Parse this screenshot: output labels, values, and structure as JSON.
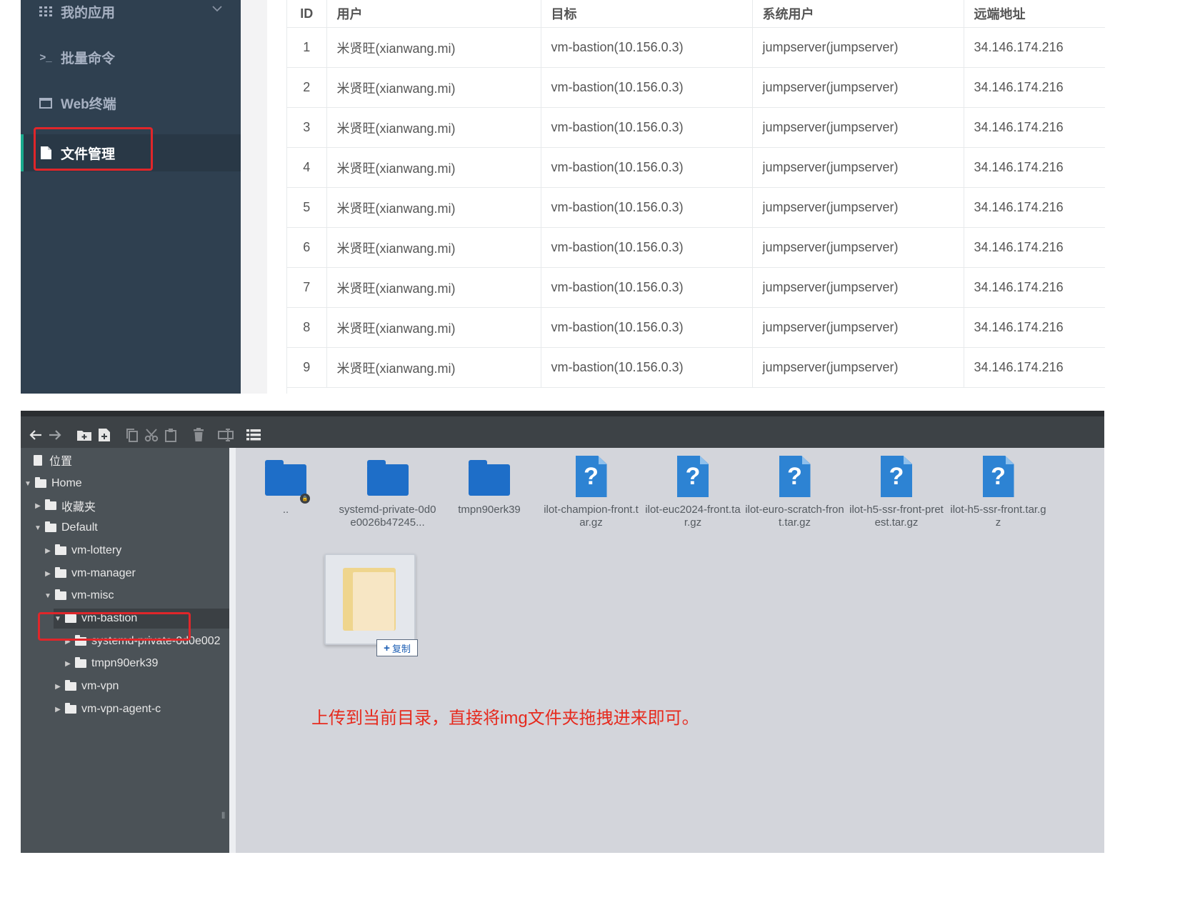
{
  "sidebar": {
    "items": [
      {
        "label": "我的应用",
        "icon": "grid-icon",
        "has_caret": true
      },
      {
        "label": "批量命令",
        "icon": "terminal-icon"
      },
      {
        "label": "Web终端",
        "icon": "window-icon"
      },
      {
        "label": "文件管理",
        "icon": "file-icon",
        "active": true
      }
    ]
  },
  "table": {
    "columns": [
      "ID",
      "用户",
      "目标",
      "系统用户",
      "远端地址"
    ],
    "rows": [
      {
        "id": "1",
        "user": "米贤旺(xianwang.mi)",
        "target": "vm-bastion(10.156.0.3)",
        "system_user": "jumpserver(jumpserver)",
        "remote_addr": "34.146.174.216"
      },
      {
        "id": "2",
        "user": "米贤旺(xianwang.mi)",
        "target": "vm-bastion(10.156.0.3)",
        "system_user": "jumpserver(jumpserver)",
        "remote_addr": "34.146.174.216"
      },
      {
        "id": "3",
        "user": "米贤旺(xianwang.mi)",
        "target": "vm-bastion(10.156.0.3)",
        "system_user": "jumpserver(jumpserver)",
        "remote_addr": "34.146.174.216"
      },
      {
        "id": "4",
        "user": "米贤旺(xianwang.mi)",
        "target": "vm-bastion(10.156.0.3)",
        "system_user": "jumpserver(jumpserver)",
        "remote_addr": "34.146.174.216"
      },
      {
        "id": "5",
        "user": "米贤旺(xianwang.mi)",
        "target": "vm-bastion(10.156.0.3)",
        "system_user": "jumpserver(jumpserver)",
        "remote_addr": "34.146.174.216"
      },
      {
        "id": "6",
        "user": "米贤旺(xianwang.mi)",
        "target": "vm-bastion(10.156.0.3)",
        "system_user": "jumpserver(jumpserver)",
        "remote_addr": "34.146.174.216"
      },
      {
        "id": "7",
        "user": "米贤旺(xianwang.mi)",
        "target": "vm-bastion(10.156.0.3)",
        "system_user": "jumpserver(jumpserver)",
        "remote_addr": "34.146.174.216"
      },
      {
        "id": "8",
        "user": "米贤旺(xianwang.mi)",
        "target": "vm-bastion(10.156.0.3)",
        "system_user": "jumpserver(jumpserver)",
        "remote_addr": "34.146.174.216"
      },
      {
        "id": "9",
        "user": "米贤旺(xianwang.mi)",
        "target": "vm-bastion(10.156.0.3)",
        "system_user": "jumpserver(jumpserver)",
        "remote_addr": "34.146.174.216"
      }
    ]
  },
  "file_manager": {
    "toolbar": [
      "back-icon",
      "forward-icon",
      "new-folder-icon",
      "new-file-icon",
      "copy-icon",
      "cut-icon",
      "paste-icon",
      "delete-icon",
      "rename-icon",
      "view-list-icon"
    ],
    "tree": [
      {
        "label": "位置",
        "icon": "places-icon"
      },
      {
        "label": "Home",
        "expanded": true
      },
      {
        "label": "收藏夹",
        "expanded": false
      },
      {
        "label": "Default",
        "expanded": true
      },
      {
        "label": "vm-lottery",
        "expanded": false
      },
      {
        "label": "vm-manager",
        "expanded": false
      },
      {
        "label": "vm-misc",
        "expanded": true
      },
      {
        "label": "vm-bastion",
        "expanded": true,
        "selected": true
      },
      {
        "label": "systemd-private-0d0e002",
        "expanded": false
      },
      {
        "label": "tmpn90erk39",
        "expanded": false
      },
      {
        "label": "vm-vpn",
        "expanded": false
      },
      {
        "label": "vm-vpn-agent-c",
        "expanded": false
      }
    ],
    "files": [
      {
        "name": "..",
        "type": "folder-locked"
      },
      {
        "name": "systemd-private-0d0e0026b47245...",
        "type": "folder"
      },
      {
        "name": "tmpn90erk39",
        "type": "folder"
      },
      {
        "name": "ilot-champion-front.tar.gz",
        "type": "unknown"
      },
      {
        "name": "ilot-euc2024-front.tar.gz",
        "type": "unknown"
      },
      {
        "name": "ilot-euro-scratch-front.tar.gz",
        "type": "unknown"
      },
      {
        "name": "ilot-h5-ssr-front-pretest.tar.gz",
        "type": "unknown"
      },
      {
        "name": "ilot-h5-ssr-front.tar.gz",
        "type": "unknown"
      }
    ],
    "drag_hint": "复制",
    "unknown_glyph": "?"
  },
  "annotation": "上传到当前目录，直接将img文件夹拖拽进来即可。",
  "colors": {
    "accent": "#19aa8d",
    "highlight": "#e0262a",
    "folder_blue": "#1e6ec8",
    "annotation": "#e62a1e"
  }
}
